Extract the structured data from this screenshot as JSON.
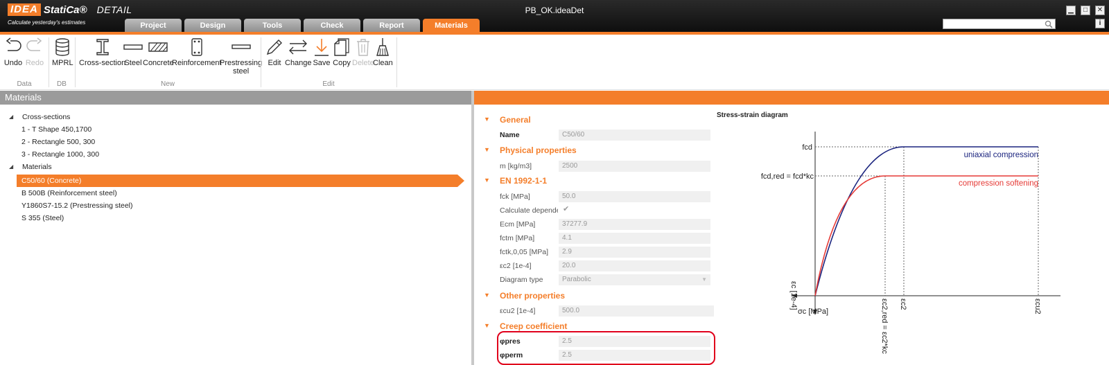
{
  "app": {
    "logo_idea": "IDEA",
    "logo_statica": "StatiCa®",
    "logo_detail": "DETAIL",
    "slogan": "Calculate yesterday's estimates",
    "document_title": "PB_OK.ideaDet"
  },
  "window_buttons": {
    "minimize": "▁",
    "maximize": "□",
    "close": "✕",
    "info": "i"
  },
  "tabs": [
    {
      "label": "Project",
      "active": false
    },
    {
      "label": "Design",
      "active": false
    },
    {
      "label": "Tools",
      "active": false
    },
    {
      "label": "Check",
      "active": false
    },
    {
      "label": "Report",
      "active": false
    },
    {
      "label": "Materials",
      "active": true
    }
  ],
  "search": {
    "value": "",
    "icon": "search-icon"
  },
  "ribbon": {
    "data_group": "Data",
    "db_group": "DB",
    "new_group": "New",
    "edit_group": "Edit",
    "undo": "Undo",
    "redo": "Redo",
    "mprl": "MPRL",
    "cross_section": "Cross-section",
    "steel": "Steel",
    "concrete": "Concrete",
    "reinforcement": "Reinforcement",
    "prestressing_1": "Prestressing",
    "prestressing_2": "steel",
    "edit": "Edit",
    "change": "Change",
    "save": "Save",
    "copy": "Copy",
    "delete": "Delete",
    "clean": "Clean"
  },
  "materials_panel": {
    "title": "Materials",
    "tree": {
      "cross_sections": "Cross-sections",
      "cs1": "1 - T Shape 450,1700",
      "cs2": "2 - Rectangle 500, 300",
      "cs3": "3 - Rectangle 1000, 300",
      "materials": "Materials",
      "m1": "C50/60 (Concrete)",
      "m2": "B 500B (Reinforcement steel)",
      "m3": "Y1860S7-15.2 (Prestressing steel)",
      "m4": "S 355 (Steel)"
    }
  },
  "properties": {
    "general": "General",
    "name_label": "Name",
    "name_value": "C50/60",
    "physical": "Physical properties",
    "m_label": "m [kg/m3]",
    "m_value": "2500",
    "en": "EN 1992-1-1",
    "fck_label": "fck [MPa]",
    "fck_value": "50.0",
    "calc_label": "Calculate dependent values",
    "calc_checked": true,
    "ecm_label": "Ecm [MPa]",
    "ecm_value": "37277.9",
    "fctm_label": "fctm [MPa]",
    "fctm_value": "4.1",
    "fctk_label": "fctk,0,05 [MPa]",
    "fctk_value": "2.9",
    "ec2_label": "εc2 [1e-4]",
    "ec2_value": "20.0",
    "diagram_type_label": "Diagram type",
    "diagram_type_value": "Parabolic",
    "other": "Other properties",
    "ecu2_label": "εcu2 [1e-4]",
    "ecu2_value": "500.0",
    "creep": "Creep coefficient",
    "phipres_label": "φpres",
    "phipres_value": "2.5",
    "phiperm_label": "φperm",
    "phiperm_value": "2.5"
  },
  "diagram": {
    "title": "Stress-strain diagram",
    "fcd": "fcd",
    "fcd_red": "fcd,red = fcd*kc",
    "uniaxial": "uniaxial compression",
    "softening": "compression softening",
    "x_axis": "εc [1e-4]",
    "y_axis": "σc [MPa]",
    "ec2_red": "εc2,red = εc2*kc",
    "ec2": "εc2",
    "ecu2": "εcu2",
    "uniaxial_color": "#1a237e",
    "softening_color": "#e53935"
  }
}
